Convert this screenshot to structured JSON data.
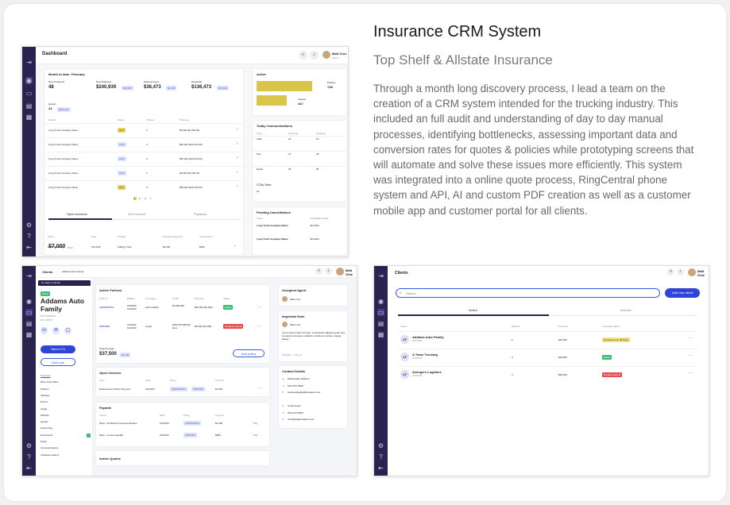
{
  "project": {
    "title": "Insurance CRM System",
    "subtitle": "Top Shelf & Allstate Insurance",
    "description": "Through a month long discovery process, I lead a team on the creation of a CRM system intended for the trucking industry. This included an full audit and understanding of day to day manual processes, identifying bottlenecks, assessing important data and conversion rates for quotes & policies while prototyping screens that will automate and solve these issues more efficiently. This system was integrated into a online quote process, RingCentral phone system and API, AI and custom PDF creation as well as a customer mobile app and customer portal for all clients."
  },
  "user": {
    "name": "Matt Cruz",
    "role": "Admin"
  },
  "dashboard": {
    "title": "Dashboard",
    "month": "Month to date: February",
    "stats": [
      {
        "label": "New Prospects",
        "value": "48",
        "tag": ""
      },
      {
        "label": "New Business",
        "value": "$240,939",
        "tag": "$34,938"
      },
      {
        "label": "Endorsements",
        "value": "$36,473",
        "tag": "$1,000"
      },
      {
        "label": "Renewals",
        "value": "$136,473",
        "tag": "$15,000"
      }
    ],
    "quotes": {
      "label": "Quotes",
      "count": "24",
      "tag": "$303,337"
    },
    "quote_headers": [
      "Clients",
      "Status",
      "Policies",
      "Premium"
    ],
    "quote_rows": [
      {
        "client": "Long Truck Company Name",
        "status": "Sent",
        "policies": "1",
        "premium": "$3,000 ($1,000.00)"
      },
      {
        "client": "Long Truck Company Name",
        "status": "Draft",
        "policies": "3",
        "premium": "$55,294 ($10,430.40)"
      },
      {
        "client": "Long Truck Company Name",
        "status": "Draft",
        "policies": "3",
        "premium": "$55,294 ($10,430.40)"
      },
      {
        "client": "Long Truck Company Name",
        "status": "Draft",
        "policies": "1",
        "premium": "$3,000 ($1,000.00)"
      },
      {
        "client": "Long Truck Company Name",
        "status": "Sent",
        "policies": "3",
        "premium": "$55,294 ($10,430.40)"
      }
    ],
    "pagination": [
      "1",
      "2",
      "3",
      ">"
    ],
    "invoice_tabs": [
      "Open Invoices",
      "Not Invoiced",
      "Payables"
    ],
    "invoice_total": "$7,000",
    "invoice_total_tag": "$700",
    "invoice_headers": [
      "Client",
      "Date",
      "Charge",
      "Payment Required",
      "Commission"
    ],
    "invoice_row": {
      "client": "ABC Trucking",
      "date": "12/13/22",
      "charge": "Adding Truck",
      "payment": "$3,000",
      "commission": "$500"
    },
    "active": {
      "label": "Active",
      "policies_label": "Policies",
      "policies": "748",
      "insured_label": "Insured",
      "insured": "447",
      "policies_frac": 0.82,
      "insured_frac": 0.45
    },
    "comms": {
      "title": "Today Communications",
      "headers": [
        "Type",
        "Incoming",
        "Outgoing"
      ],
      "rows": [
        {
          "type": "Calls",
          "in": "24",
          "out": "16"
        },
        {
          "type": "Text",
          "in": "12",
          "out": "43"
        },
        {
          "type": "Email",
          "in": "35",
          "out": "65"
        }
      ],
      "coi_label": "COIs Sent",
      "coi_value": "12"
    },
    "cancellations": {
      "title": "Pending Cancellations",
      "headers": [
        "Client",
        "Cancellation Date"
      ],
      "rows": [
        {
          "client": "Long Truck Company Name",
          "date": "02/10/22"
        },
        {
          "client": "Long Truck Company Name",
          "date": "02/16/22"
        }
      ]
    }
  },
  "client_detail": {
    "breadcrumb_root": "Clients",
    "breadcrumb_leaf": "Addams Auto Family",
    "back": "Go back to clients",
    "status": "Active",
    "name": "Addams Auto Family",
    "dot": "DOT: 2238197",
    "mc": "MC: 95765",
    "send_coi": "Send COI",
    "add_note": "Add note",
    "nav": [
      "Overview",
      "More Information",
      "Policies",
      "Vehicles",
      "Drivers",
      "Cargo",
      "FMCSA",
      "Quotes",
      "Accounting",
      "Documents",
      "Notes",
      "Communications",
      "Insurance History"
    ],
    "active_policies": "Active Policies",
    "policy_headers": [
      "Policy #",
      "Eff/Exp",
      "Coverage",
      "Limits",
      "Premium",
      "Status"
    ],
    "policies": [
      {
        "num": "AAD0I9753-3",
        "dates": "10/29/22 10/29/23",
        "coverage": "Auto Liability",
        "limits": "$1,000,000",
        "premium": "$30,000 ($1,000)",
        "status": "Active"
      },
      {
        "num": "CPD0464",
        "dates": "10/29/22 10/29/23",
        "coverage": "Cargo",
        "limits": "$100,000 $5,000 Ded.",
        "premium": "$5,000 ($1,000)",
        "status": "Pending Cancel"
      }
    ],
    "total_premium_label": "Total Premium",
    "total_premium": "$37,500",
    "total_tag": "$3,700",
    "add_policy": "Add policy",
    "open_invoices": "Open Invoices",
    "invoice_headers": [
      "Type",
      "Date",
      "Policy",
      "Amount"
    ],
    "invoice_row": {
      "type": "Endorsement Down Payment",
      "date": "10/19/22",
      "policy": "AAD0I9753-3",
      "policy2": "CPD0464",
      "amount": "$1,000"
    },
    "payable": "Payable",
    "payable_headers": [
      "Insurer",
      "Date",
      "Policy",
      "Amount"
    ],
    "payable_rows": [
      {
        "insurer": "MGA - Strickland Insurance Brokers",
        "date": "10/29/23",
        "policy": "AAD0I9753-3",
        "amount": "$1,000",
        "action": "Pay"
      },
      {
        "insurer": "MGA - Commonwealth",
        "date": "10/29/23",
        "policy": "CPD0464",
        "amount": "$856",
        "action": "Pay"
      }
    ],
    "active_quotes": "Active Quotes",
    "assigned_agent_title": "Assigned Agent",
    "assigned_agent": "Matt Cruz",
    "important_note_title": "Important Note",
    "note_author": "Matt Cruz",
    "note_text": "Lorem ipsum dolor sit amet, consectetur adipiscing elit, sed do eiusmod tempor incididunt ut labore et dolore magna aliqua.",
    "note_date": "10/19/22 · 1:02 pm",
    "contact_title": "Contact Details",
    "contacts": [
      {
        "name": "Wednesday Addams",
        "phone": "619-XXX-5555",
        "email": "wednesday@addamsauto.com"
      },
      {
        "name": "Uncle Fester",
        "phone": "619-XXX-5555",
        "email": "uncle@addamsauto.com"
      }
    ]
  },
  "clients_list": {
    "title": "Clients",
    "search_placeholder": "Search",
    "add_button": "Add new client",
    "tabs": [
      "Active",
      "Inactive"
    ],
    "headers": [
      "Client",
      "Policies",
      "Premium",
      "Coverage Status"
    ],
    "rows": [
      {
        "initials": "AF",
        "name": "Addams Auto Family",
        "sub": "DOT12345",
        "policies": "2",
        "premium": "$25,000",
        "status": "Renewal soon 28 Days",
        "status_color": "#f1e27a"
      },
      {
        "initials": "AF",
        "name": "A Team Trucking",
        "sub": "DOT12345",
        "policies": "3",
        "premium": "$30,000",
        "status": "Active",
        "status_color": "#3fbf74"
      },
      {
        "initials": "AF",
        "name": "Avengers Logistics",
        "sub": "DOT12345",
        "policies": "4",
        "premium": "$80,000",
        "status": "Pending Cancel",
        "status_color": "#e44e4e"
      }
    ]
  }
}
